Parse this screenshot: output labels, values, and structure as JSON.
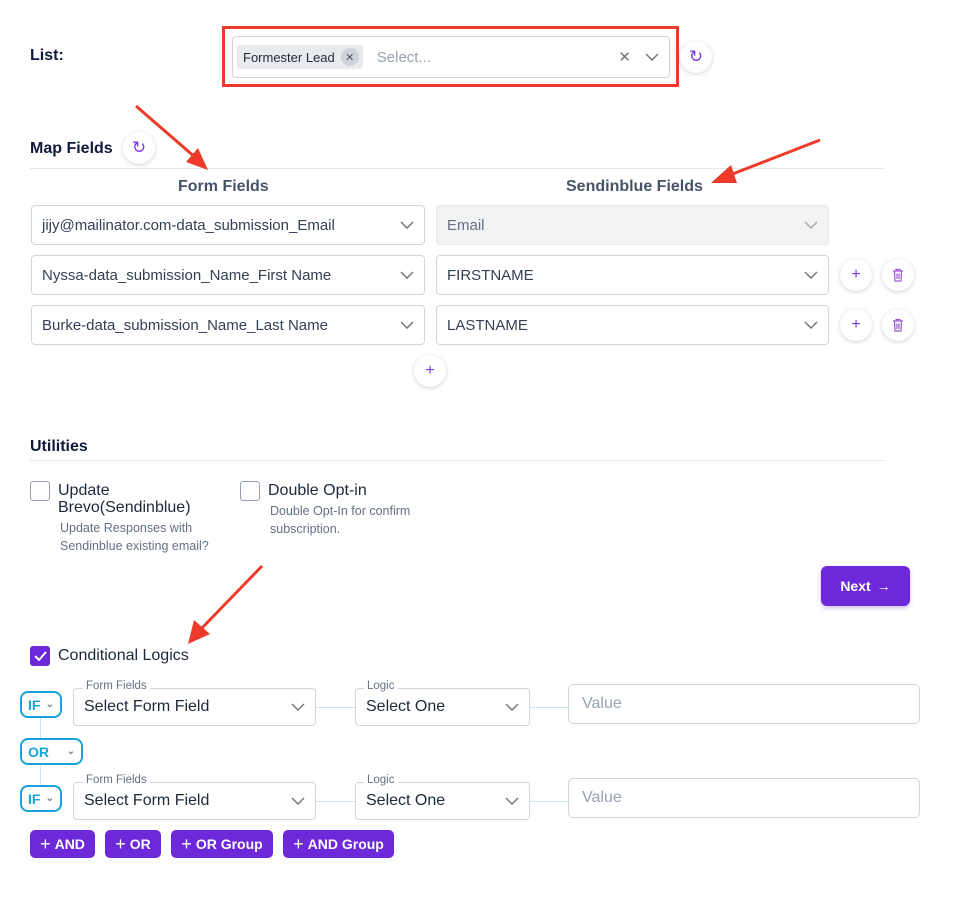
{
  "list": {
    "label": "List:",
    "tag": "Formester Lead",
    "placeholder": "Select..."
  },
  "map_fields": {
    "title": "Map Fields",
    "form_fields_header": "Form Fields",
    "sendinblue_fields_header": "Sendinblue Fields",
    "rows": [
      {
        "form_field": "jijy@mailinator.com-data_submission_Email",
        "sendinblue_field": "Email"
      },
      {
        "form_field": "Nyssa-data_submission_Name_First Name",
        "sendinblue_field": "FIRSTNAME"
      },
      {
        "form_field": "Burke-data_submission_Name_Last Name",
        "sendinblue_field": "LASTNAME"
      }
    ]
  },
  "utilities": {
    "title": "Utilities",
    "update": {
      "label_line1": "Update",
      "label_line2": "Brevo(Sendinblue)",
      "help_line1": "Update Responses with",
      "help_line2": "Sendinblue existing email?"
    },
    "double_optin": {
      "label": "Double Opt-in",
      "help_line1": "Double Opt-In for confirm",
      "help_line2": "subscription."
    }
  },
  "next_label": "Next",
  "conditional": {
    "label": "Conditional Logics",
    "if_label": "IF",
    "or_label": "OR",
    "form_fields_label": "Form Fields",
    "logic_label": "Logic",
    "field_placeholder": "Select Form Field",
    "logic_placeholder": "Select One",
    "value_placeholder": "Value",
    "buttons": {
      "and": "AND",
      "or": "OR",
      "or_group": "OR Group",
      "and_group": "AND Group"
    }
  },
  "colors": {
    "accent": "#6d28d9",
    "operator": "#16a3d9",
    "annotation": "#ee3a2a"
  }
}
